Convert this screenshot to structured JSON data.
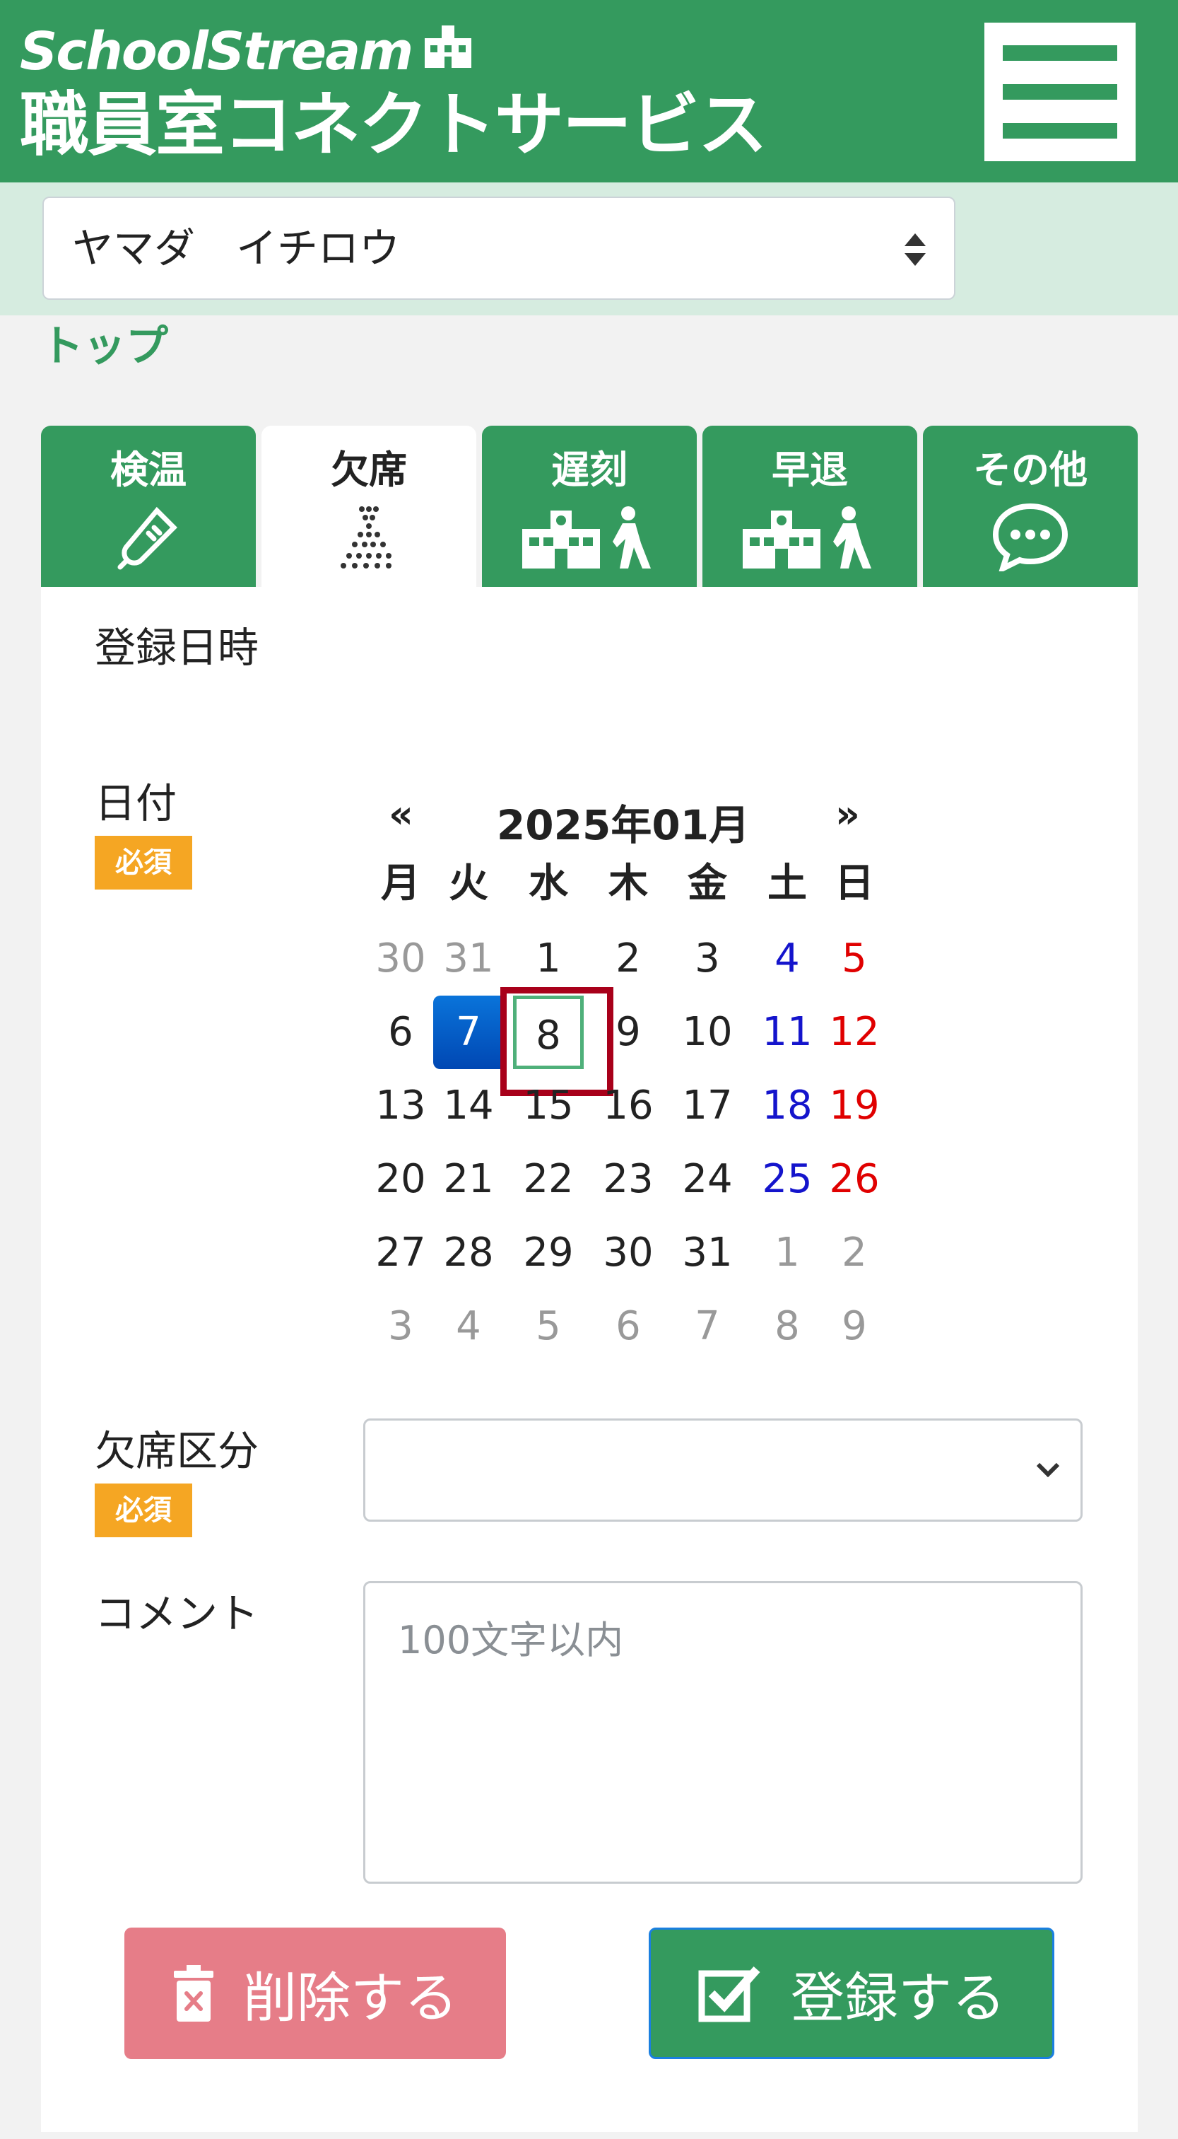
{
  "header": {
    "brand_top": "SchoolStream",
    "brand_bottom": "職員室コネクトサービス"
  },
  "student": {
    "name": "ヤマダ　イチロウ"
  },
  "breadcrumb": "トップ",
  "tabs": [
    {
      "label": "検温",
      "icon": "thermometer-icon"
    },
    {
      "label": "欠席",
      "icon": "absence-icon",
      "active": true
    },
    {
      "label": "遅刻",
      "icon": "school-walk-icon"
    },
    {
      "label": "早退",
      "icon": "school-walk-icon"
    },
    {
      "label": "その他",
      "icon": "chat-bubble-icon"
    }
  ],
  "form": {
    "registered_label": "登録日時",
    "date_label": "日付",
    "required_badge": "必須",
    "absence_type_label": "欠席区分",
    "comment_label": "コメント",
    "comment_placeholder": "100文字以内"
  },
  "calendar": {
    "prev": "«",
    "title": "2025年01月",
    "next": "»",
    "weekdays": [
      "月",
      "火",
      "水",
      "木",
      "金",
      "土",
      "日"
    ],
    "weeks": [
      [
        "30",
        "31",
        "1",
        "2",
        "3",
        "4",
        "5"
      ],
      [
        "6",
        "7",
        "8",
        "9",
        "10",
        "11",
        "12"
      ],
      [
        "13",
        "14",
        "15",
        "16",
        "17",
        "18",
        "19"
      ],
      [
        "20",
        "21",
        "22",
        "23",
        "24",
        "25",
        "26"
      ],
      [
        "27",
        "28",
        "29",
        "30",
        "31",
        "1",
        "2"
      ],
      [
        "3",
        "4",
        "5",
        "6",
        "7",
        "8",
        "9"
      ]
    ],
    "selected_day": "7",
    "highlighted_day": "8",
    "colors": {
      "saturday": "#1414cc",
      "sunday": "#e00000",
      "other_month": "#999999"
    }
  },
  "buttons": {
    "delete": "削除する",
    "submit": "登録する"
  },
  "colors": {
    "brand": "#349a5e",
    "delete": "#e67d88",
    "required": "#f5a623"
  }
}
